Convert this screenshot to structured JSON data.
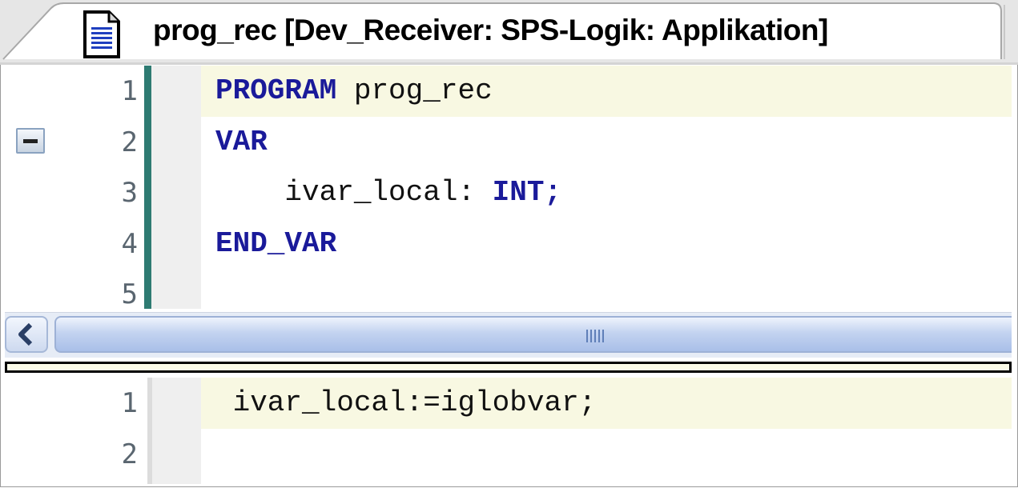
{
  "window": {
    "tab_title": "prog_rec [Dev_Receiver: SPS-Logik: Applikation]",
    "tab_icon": "document-icon"
  },
  "declaration_editor": {
    "lines": [
      {
        "number": "1",
        "segments": [
          {
            "text": "PROGRAM",
            "kind": "keyword"
          },
          {
            "text": " prog_rec",
            "kind": "plain"
          }
        ]
      },
      {
        "number": "2",
        "segments": [
          {
            "text": "VAR",
            "kind": "keyword"
          }
        ]
      },
      {
        "number": "3",
        "segments": [
          {
            "text": "    ivar_local: ",
            "kind": "plain"
          },
          {
            "text": "INT;",
            "kind": "keyword"
          }
        ]
      },
      {
        "number": "4",
        "segments": [
          {
            "text": "END_VAR",
            "kind": "keyword"
          }
        ]
      },
      {
        "number": "5",
        "segments": []
      }
    ],
    "fold_icon": "collapse-minus-icon"
  },
  "scrollbar": {
    "left_icon": "chevron-left-icon",
    "grip_icon": "grip-icon"
  },
  "implementation_editor": {
    "lines": [
      {
        "number": "1",
        "segments": [
          {
            "text": " ivar_local:=iglobvar;",
            "kind": "plain"
          }
        ]
      },
      {
        "number": "2",
        "segments": []
      }
    ]
  },
  "colors": {
    "keyword": "#1a1a9a",
    "change_bar": "#2e7b72",
    "line_highlight": "#f8f8e2"
  }
}
